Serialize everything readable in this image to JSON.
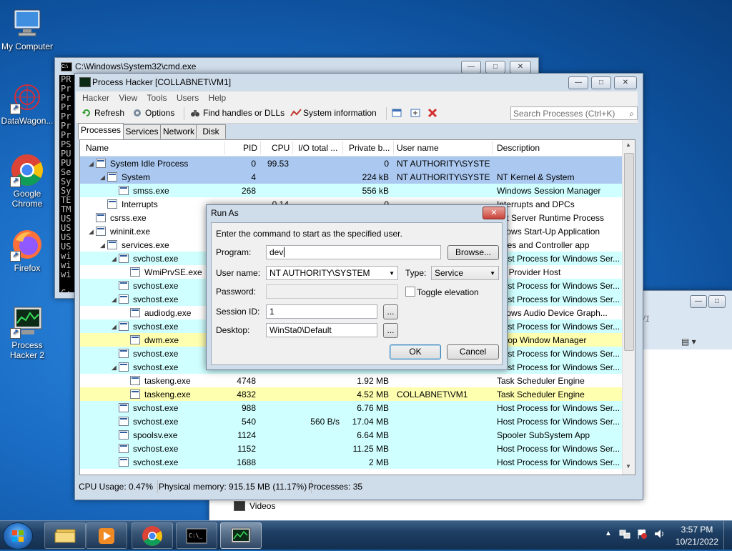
{
  "desktop": {
    "icons": [
      {
        "label": "My Computer"
      },
      {
        "label": "DataWagon..."
      },
      {
        "label": "Google Chrome"
      },
      {
        "label": "Firefox"
      },
      {
        "label": "Process Hacker 2"
      }
    ]
  },
  "cmd_window": {
    "title": "C:\\Windows\\System32\\cmd.exe",
    "lines": [
      "PR",
      "Pr",
      "Pr",
      "Pr",
      "Pr",
      "Pr",
      "Pr",
      "PS",
      "PU",
      "PU",
      "Se",
      "Sy",
      "Sy",
      "TE",
      "TM",
      "US",
      "US",
      "US",
      "US",
      "wi",
      "wi",
      "wi",
      "",
      "C:"
    ]
  },
  "explorer_window": {
    "partial_text": "/1",
    "nav_item": "Videos"
  },
  "process_hacker": {
    "title": "Process Hacker [COLLABNET\\VM1]",
    "menu": [
      "Hacker",
      "View",
      "Tools",
      "Users",
      "Help"
    ],
    "toolbar": {
      "refresh": "Refresh",
      "options": "Options",
      "find_handles": "Find handles or DLLs",
      "system_info": "System information",
      "search_placeholder": "Search Processes (Ctrl+K)"
    },
    "tabs": [
      "Processes",
      "Services",
      "Network",
      "Disk"
    ],
    "columns": [
      "Name",
      "PID",
      "CPU",
      "I/O total ...",
      "Private b...",
      "User name",
      "Description"
    ],
    "rows": [
      {
        "name": "System Idle Process",
        "pid": "0",
        "cpu": "99.53",
        "io": "",
        "priv": "0",
        "user": "NT AUTHORITY\\SYSTEM",
        "desc": ""
      },
      {
        "name": "System",
        "pid": "4",
        "cpu": "",
        "io": "",
        "priv": "224 kB",
        "user": "NT AUTHORITY\\SYSTEM",
        "desc": "NT Kernel & System"
      },
      {
        "name": "smss.exe",
        "pid": "268",
        "cpu": "",
        "io": "",
        "priv": "556 kB",
        "user": "",
        "desc": "Windows Session Manager"
      },
      {
        "name": "Interrupts",
        "pid": "",
        "cpu": "0.14",
        "io": "",
        "priv": "0",
        "user": "",
        "desc": "Interrupts and DPCs"
      },
      {
        "name": "csrss.exe",
        "pid": "",
        "cpu": "",
        "io": "",
        "priv": "",
        "user": "",
        "desc": "ent Server Runtime Process"
      },
      {
        "name": "wininit.exe",
        "pid": "",
        "cpu": "",
        "io": "",
        "priv": "",
        "user": "",
        "desc": "ndows Start-Up Application"
      },
      {
        "name": "services.exe",
        "pid": "",
        "cpu": "",
        "io": "",
        "priv": "",
        "user": "",
        "desc": "vices and Controller app"
      },
      {
        "name": "svchost.exe",
        "pid": "",
        "cpu": "",
        "io": "",
        "priv": "",
        "user": "",
        "desc": "Host Process for Windows Ser..."
      },
      {
        "name": "WmiPrvSE.exe",
        "pid": "",
        "cpu": "",
        "io": "",
        "priv": "",
        "user": "",
        "desc": "MI Provider Host"
      },
      {
        "name": "svchost.exe",
        "pid": "",
        "cpu": "",
        "io": "",
        "priv": "",
        "user": "",
        "desc": "Host Process for Windows Ser..."
      },
      {
        "name": "svchost.exe",
        "pid": "",
        "cpu": "",
        "io": "",
        "priv": "",
        "user": "",
        "desc": "Host Process for Windows Ser..."
      },
      {
        "name": "audiodg.exe",
        "pid": "",
        "cpu": "",
        "io": "",
        "priv": "",
        "user": "",
        "desc": "ndows Audio Device Graph..."
      },
      {
        "name": "svchost.exe",
        "pid": "",
        "cpu": "",
        "io": "",
        "priv": "",
        "user": "",
        "desc": "Host Process for Windows Ser..."
      },
      {
        "name": "dwm.exe",
        "pid": "",
        "cpu": "",
        "io": "",
        "priv": "",
        "user": "",
        "desc": "sktop Window Manager"
      },
      {
        "name": "svchost.exe",
        "pid": "",
        "cpu": "",
        "io": "",
        "priv": "",
        "user": "",
        "desc": "Host Process for Windows Ser..."
      },
      {
        "name": "svchost.exe",
        "pid": "",
        "cpu": "",
        "io": "",
        "priv": "",
        "user": "",
        "desc": "Host Process for Windows Ser..."
      },
      {
        "name": "taskeng.exe",
        "pid": "4748",
        "cpu": "",
        "io": "",
        "priv": "1.92 MB",
        "user": "",
        "desc": "Task Scheduler Engine"
      },
      {
        "name": "taskeng.exe",
        "pid": "4832",
        "cpu": "",
        "io": "",
        "priv": "4.52 MB",
        "user": "COLLABNET\\VM1",
        "desc": "Task Scheduler Engine"
      },
      {
        "name": "svchost.exe",
        "pid": "988",
        "cpu": "",
        "io": "",
        "priv": "6.76 MB",
        "user": "",
        "desc": "Host Process for Windows Ser..."
      },
      {
        "name": "svchost.exe",
        "pid": "540",
        "cpu": "",
        "io": "560 B/s",
        "priv": "17.04 MB",
        "user": "",
        "desc": "Host Process for Windows Ser..."
      },
      {
        "name": "spoolsv.exe",
        "pid": "1124",
        "cpu": "",
        "io": "",
        "priv": "6.64 MB",
        "user": "",
        "desc": "Spooler SubSystem App"
      },
      {
        "name": "svchost.exe",
        "pid": "1152",
        "cpu": "",
        "io": "",
        "priv": "11.25 MB",
        "user": "",
        "desc": "Host Process for Windows Ser..."
      },
      {
        "name": "svchost.exe",
        "pid": "1688",
        "cpu": "",
        "io": "",
        "priv": "2 MB",
        "user": "",
        "desc": "Host Process for Windows Ser..."
      }
    ],
    "status": {
      "cpu": "CPU Usage: 0.47%",
      "memory": "Physical memory: 915.15 MB (11.17%)",
      "processes": "Processes: 35"
    }
  },
  "run_as": {
    "title": "Run As",
    "instruction": "Enter the command to start as the specified user.",
    "program_label": "Program:",
    "program_value": "dev",
    "browse": "Browse...",
    "username_label": "User name:",
    "username_value": "NT AUTHORITY\\SYSTEM",
    "type_label": "Type:",
    "type_value": "Service",
    "password_label": "Password:",
    "toggle_elevation": "Toggle elevation",
    "session_label": "Session ID:",
    "session_value": "1",
    "desktop_label": "Desktop:",
    "desktop_value": "WinSta0\\Default",
    "ellipsis": "...",
    "ok": "OK",
    "cancel": "Cancel"
  },
  "taskbar": {
    "time": "3:57 PM",
    "date": "10/21/2022"
  },
  "colors": {
    "service_row": "#d0ffff",
    "system_row": "#aac8f0",
    "own_process_row": "#ffffb0",
    "close_button": "#c9423a"
  }
}
